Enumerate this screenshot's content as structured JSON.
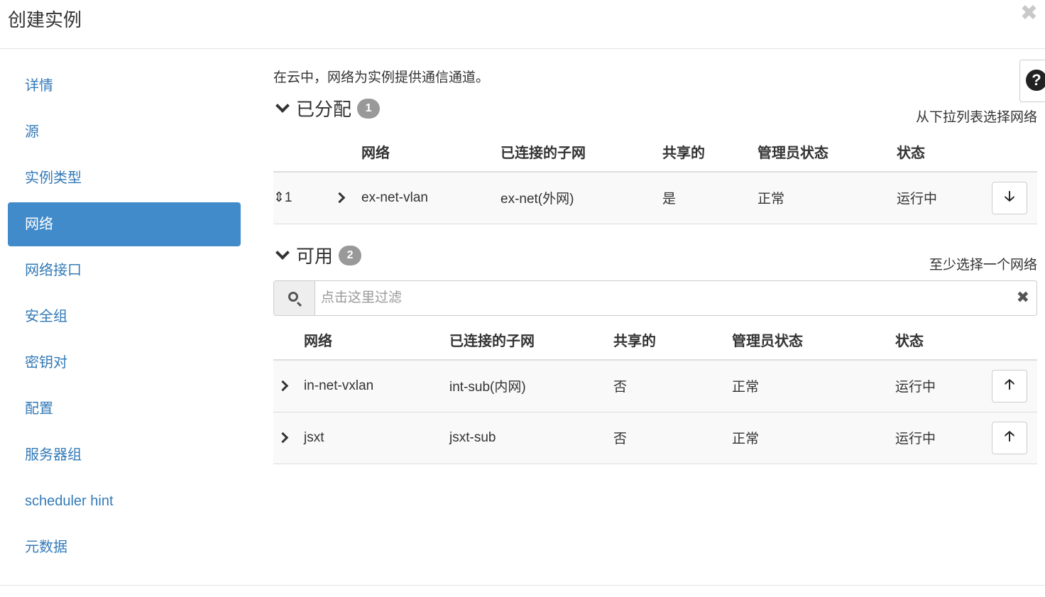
{
  "dialog": {
    "title": "创建实例",
    "close_glyph": "✖"
  },
  "sidebar": {
    "items": [
      {
        "label": "详情",
        "active": false
      },
      {
        "label": "源",
        "active": false
      },
      {
        "label": "实例类型",
        "active": false
      },
      {
        "label": "网络",
        "active": true
      },
      {
        "label": "网络接口",
        "active": false
      },
      {
        "label": "安全组",
        "active": false
      },
      {
        "label": "密钥对",
        "active": false
      },
      {
        "label": "配置",
        "active": false
      },
      {
        "label": "服务器组",
        "active": false
      },
      {
        "label": "scheduler hint",
        "active": false
      },
      {
        "label": "元数据",
        "active": false
      }
    ]
  },
  "main": {
    "intro": "在云中，网络为实例提供通信通道。",
    "help_glyph": "?",
    "allocated": {
      "title": "已分配",
      "count": "1",
      "hint": "从下拉列表选择网络",
      "headers": [
        "网络",
        "已连接的子网",
        "共享的",
        "管理员状态",
        "状态"
      ],
      "rows": [
        {
          "order": "1",
          "network": "ex-net-vlan",
          "subnet": "ex-net(外网)",
          "shared": "是",
          "admin_state": "正常",
          "status": "运行中"
        }
      ]
    },
    "available": {
      "title": "可用",
      "count": "2",
      "hint": "至少选择一个网络",
      "filter_placeholder": "点击这里过滤",
      "filter_value": "",
      "headers": [
        "网络",
        "已连接的子网",
        "共享的",
        "管理员状态",
        "状态"
      ],
      "rows": [
        {
          "network": "in-net-vxlan",
          "subnet": "int-sub(内网)",
          "shared": "否",
          "admin_state": "正常",
          "status": "运行中"
        },
        {
          "network": "jsxt",
          "subnet": "jsxt-sub",
          "shared": "否",
          "admin_state": "正常",
          "status": "运行中"
        }
      ]
    }
  },
  "icons": {
    "sort": "sort-icon",
    "move_down": "arrow-down-icon",
    "move_up": "arrow-up-icon",
    "clear_filter": "clear-icon"
  },
  "glyphs": {
    "sort": "⇕",
    "down": "🡣",
    "up": "🡡",
    "clear": "✖"
  },
  "colors": {
    "link": "#337ab7",
    "active_bg": "#428bca",
    "badge": "#999999",
    "row_bg": "#f9f9f9",
    "border": "#dddddd"
  }
}
